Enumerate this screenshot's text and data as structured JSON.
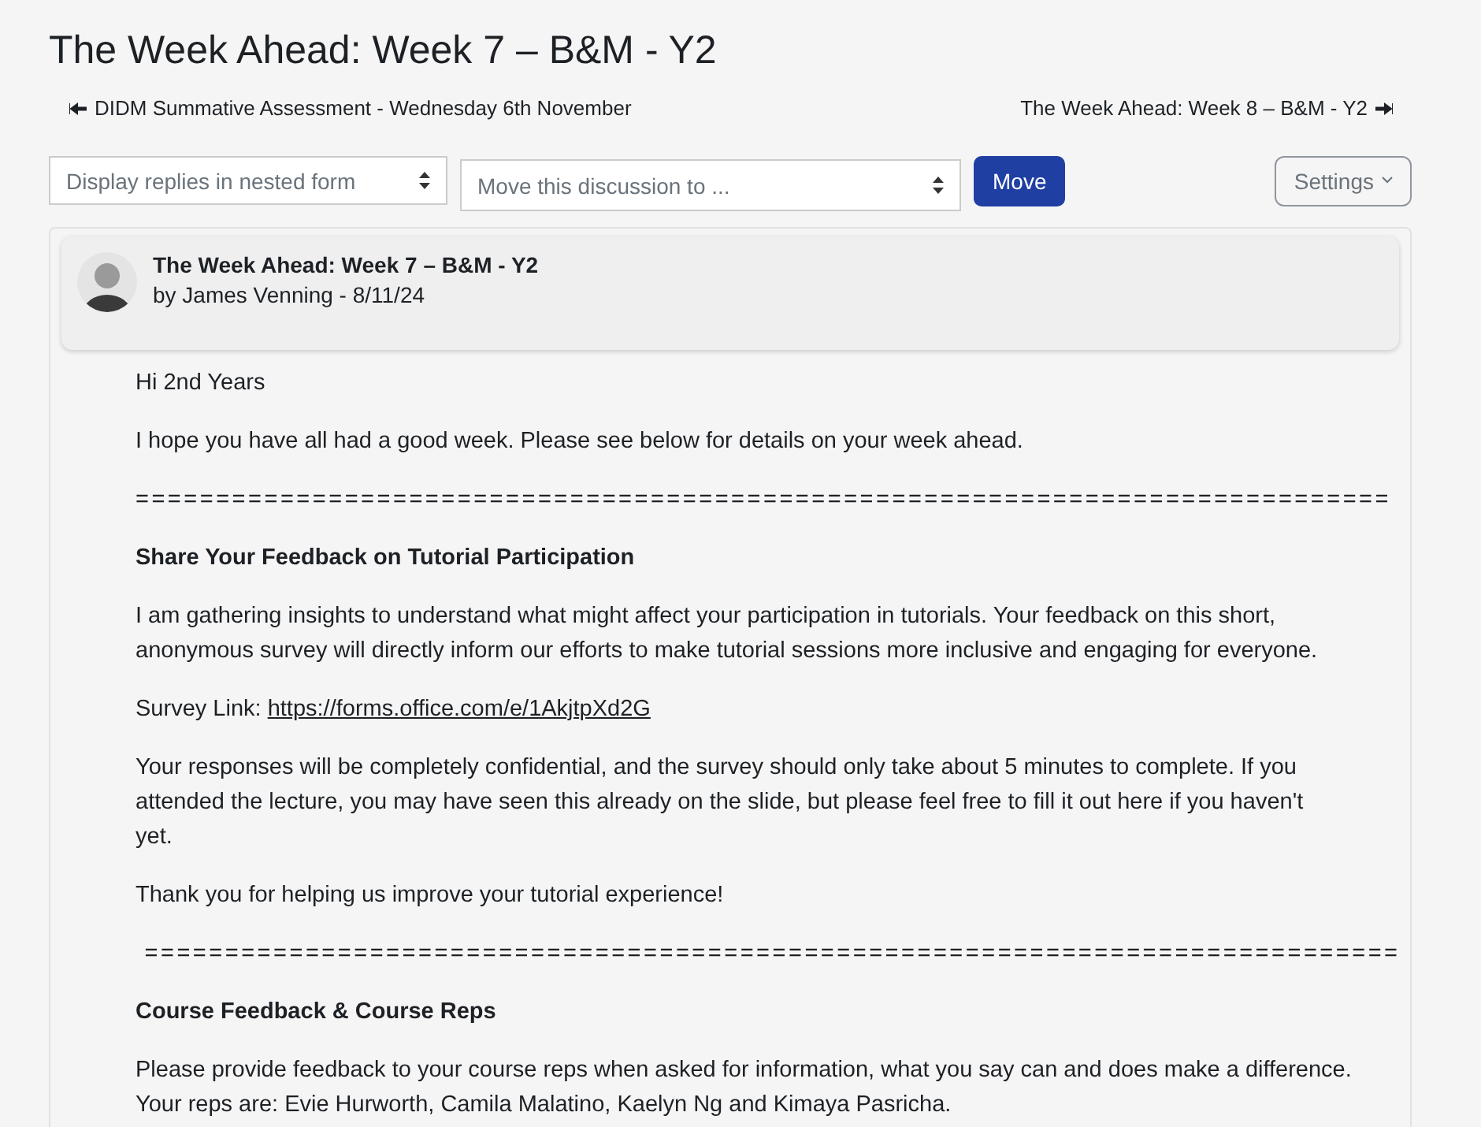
{
  "page": {
    "title": "The Week Ahead: Week 7 – B&M - Y2"
  },
  "navigation": {
    "previous": "DIDM Summative Assessment - Wednesday 6th November",
    "next": "The Week Ahead: Week 8 – B&M - Y2"
  },
  "controls": {
    "display_mode": "Display replies in nested form",
    "move_target": "Move this discussion to ...",
    "move_button": "Move",
    "settings_button": "Settings"
  },
  "post": {
    "title": "The Week Ahead: Week 7 – B&M - Y2",
    "byline": "by James Venning - 8/11/24",
    "body": [
      {
        "kind": "paragraph",
        "lines": [
          "Hi 2nd Years"
        ]
      },
      {
        "kind": "paragraph",
        "lines": [
          "I hope you have all had a good week. Please see below for details on your week ahead."
        ]
      },
      {
        "kind": "separator",
        "text": "=============================================================================="
      },
      {
        "kind": "heading",
        "text": "Share Your Feedback on Tutorial Participation"
      },
      {
        "kind": "paragraph",
        "lines": [
          "I am gathering insights to understand what might affect your participation in tutorials. Your feedback on this short,",
          "anonymous survey will directly inform our efforts to make tutorial sessions more inclusive and engaging for everyone."
        ]
      },
      {
        "kind": "link",
        "label": "Survey Link: ",
        "url": "https://forms.office.com/e/1AkjtpXd2G"
      },
      {
        "kind": "paragraph",
        "lines": [
          "Your responses will be completely confidential, and the survey should only take about 5 minutes to complete. If you",
          "attended the lecture, you may have seen this already on the slide, but please feel free to fill it out here if you haven't",
          "yet."
        ]
      },
      {
        "kind": "paragraph",
        "lines": [
          "Thank you for helping us improve your tutorial experience!"
        ]
      },
      {
        "kind": "separator",
        "text": " =============================================================================="
      },
      {
        "kind": "heading",
        "text": "Course Feedback & Course Reps"
      },
      {
        "kind": "paragraph",
        "lines": [
          "Please provide feedback to your course reps when asked for information, what you say can and does make a difference.",
          "Your reps are: Evie Hurworth, Camila Malatino, Kaelyn Ng and Kimaya Pasricha."
        ]
      }
    ]
  }
}
